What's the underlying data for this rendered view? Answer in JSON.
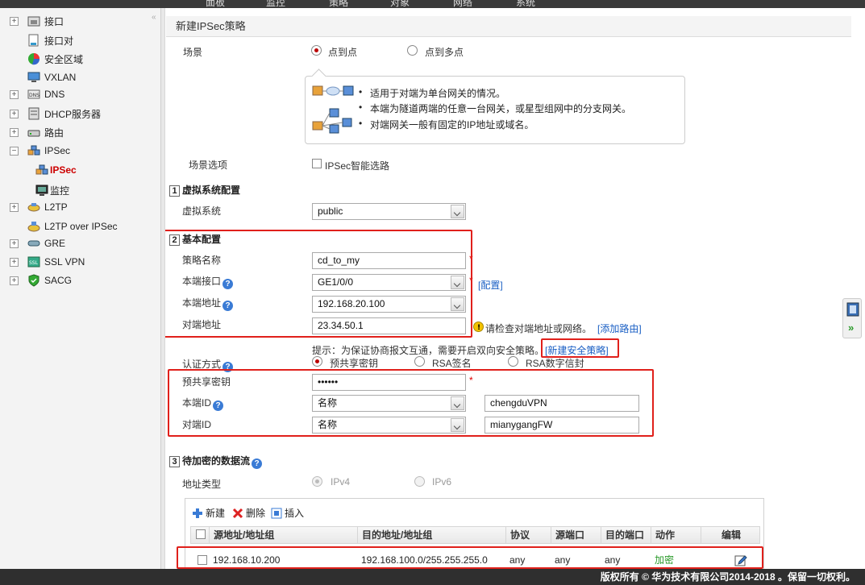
{
  "topnav": {
    "tabs": [
      "面板",
      "监控",
      "策略",
      "对象",
      "网络",
      "系统"
    ]
  },
  "sidebar": {
    "collapse_glyph": "«",
    "items": [
      {
        "label": "接口",
        "toggle": "+"
      },
      {
        "label": "接口对",
        "toggle": ""
      },
      {
        "label": "安全区域",
        "toggle": ""
      },
      {
        "label": "VXLAN",
        "toggle": ""
      },
      {
        "label": "DNS",
        "toggle": "+"
      },
      {
        "label": "DHCP服务器",
        "toggle": "+"
      },
      {
        "label": "路由",
        "toggle": "+"
      },
      {
        "label": "IPSec",
        "toggle": "−"
      },
      {
        "label": "IPSec",
        "toggle": ""
      },
      {
        "label": "监控",
        "toggle": ""
      },
      {
        "label": "L2TP",
        "toggle": "+"
      },
      {
        "label": "L2TP over IPSec",
        "toggle": ""
      },
      {
        "label": "GRE",
        "toggle": "+"
      },
      {
        "label": "SSL VPN",
        "toggle": "+"
      },
      {
        "label": "SACG",
        "toggle": "+"
      }
    ]
  },
  "page": {
    "title": "新建IPSec策略"
  },
  "scenario": {
    "label": "场景",
    "option1": "点到点",
    "option2": "点到多点",
    "bullets": [
      "适用于对端为单台网关的情况。",
      "本端为隧道两端的任意一台网关，或星型组网中的分支网关。",
      "对端网关一般有固定的IP地址或域名。"
    ],
    "options_label": "场景选项",
    "smart_label": "IPSec智能选路"
  },
  "vsys": {
    "num": "1",
    "title": "虚拟系统配置",
    "label": "虚拟系统",
    "value": "public"
  },
  "basic": {
    "num": "2",
    "title": "基本配置",
    "name_label": "策略名称",
    "name_value": "cd_to_my",
    "iface_label": "本端接口",
    "iface_value": "GE1/0/0",
    "iface_link": "[配置]",
    "local_label": "本端地址",
    "local_value": "192.168.20.100",
    "peer_label": "对端地址",
    "peer_value": "23.34.50.1",
    "peer_warn": "请检查对端地址或网络。",
    "route_link": "[添加路由]",
    "hint": "提示：为保证协商报文互通，需要开启双向安全策略。",
    "policy_link": "[新建安全策略]"
  },
  "auth": {
    "label": "认证方式",
    "opt1": "预共享密钥",
    "opt2": "RSA签名",
    "opt3": "RSA数字信封",
    "psk_label": "预共享密钥",
    "psk_value": "••••••",
    "local_id_label": "本端ID",
    "local_id_type": "名称",
    "local_id_value": "chengduVPN",
    "peer_id_label": "对端ID",
    "peer_id_type": "名称",
    "peer_id_value": "mianygangFW"
  },
  "flow": {
    "num": "3",
    "title": "待加密的数据流",
    "addr_type_label": "地址类型",
    "ipv4": "IPv4",
    "ipv6": "IPv6",
    "toolbar": {
      "new": "新建",
      "delete": "删除",
      "insert": "插入"
    },
    "columns": [
      "源地址/地址组",
      "目的地址/地址组",
      "协议",
      "源端口",
      "目的端口",
      "动作",
      "编辑"
    ],
    "rows": [
      {
        "src": "192.168.10.200",
        "dst": "192.168.100.0/255.255.255.0",
        "proto": "any",
        "sport": "any",
        "dport": "any",
        "action": "加密"
      }
    ]
  },
  "footer": {
    "copyright": "版权所有 © 华为技术有限公司2014-2018 。保留一切权利。"
  },
  "colors": {
    "accent_red": "#e0201b",
    "link_blue": "#1a5fc4",
    "action_green": "#2a9a2a"
  }
}
